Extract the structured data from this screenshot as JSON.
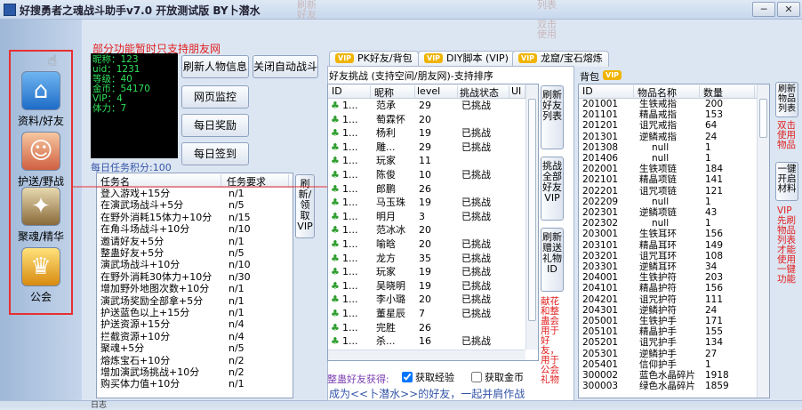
{
  "window": {
    "title": "好搜勇者之魂战斗助手v7.0 开放测试版 BY卜潜水",
    "ghost_labels": [
      "刷新好友",
      "列表",
      "双击使用"
    ],
    "minimize": "─",
    "close": "✕"
  },
  "nav": [
    {
      "label": "资料/好友",
      "icon": "home-icon"
    },
    {
      "label": "护送/野战",
      "icon": "people-icon"
    },
    {
      "label": "聚魂/精华",
      "icon": "items-icon"
    },
    {
      "label": "公会",
      "icon": "guild-icon"
    }
  ],
  "notice": "部分功能暂时只支持朋友网",
  "stats": [
    "昵称：123",
    "uid：1231",
    "等级：40",
    "金币：54170",
    "VIP：4",
    "体力：7"
  ],
  "buttons": {
    "refresh_info": "刷新人物信息",
    "close_auto": "关闭自动战斗",
    "web_monitor": "网页监控",
    "daily_reward": "每日奖励",
    "daily_signin": "每日签到",
    "refresh_receive_vip": "刷新/领取VIP",
    "refresh_friends": "刷新好友列表",
    "challenge_all_vip": "挑战全部好友VIP",
    "refresh_gift_id": "刷新赠送礼物ID",
    "one_click_open": "一键开启材料",
    "refresh_items_list": "刷新物品列表"
  },
  "daily_task": {
    "points_label": "每日任务积分:100",
    "columns": [
      "任务名",
      "任务要求"
    ],
    "rows": [
      [
        "登入游戏+15分",
        "n/1"
      ],
      [
        "在演武场战斗+5分",
        "n/5"
      ],
      [
        "在野外消耗15体力+10分",
        "n/15"
      ],
      [
        "在角斗场战斗+10分",
        "n/10"
      ],
      [
        "邀请好友+5分",
        "n/1"
      ],
      [
        "整蛊好友+5分",
        "n/5"
      ],
      [
        "演武场战斗+10分",
        "n/10"
      ],
      [
        "在野外消耗30体力+10分",
        "n/30"
      ],
      [
        "增加野外地图次数+10分",
        "n/1"
      ],
      [
        "演武场奖励全部拿+5分",
        "n/1"
      ],
      [
        "护送蓝色以上+15分",
        "n/1"
      ],
      [
        "护送资源+15分",
        "n/4"
      ],
      [
        "拦截资源+10分",
        "n/4"
      ],
      [
        "聚魂+5分",
        "n/5"
      ],
      [
        "熔炼宝石+10分",
        "n/2"
      ],
      [
        "增加演武场挑战+10分",
        "n/2"
      ],
      [
        "购买体力值+10分",
        "n/1"
      ]
    ]
  },
  "tabs": [
    "PK好友/背包",
    "DIY脚本 (VIP)",
    "龙窟/宝石熔炼"
  ],
  "tab_vip_badge": "VIP",
  "friends": {
    "heading": "好友挑战 (支持空间/朋友网)-支持排序",
    "columns": [
      "ID",
      "昵称",
      "level",
      "挑战状态",
      "UI"
    ],
    "rows": [
      [
        "1...",
        "范承",
        "29",
        "已挑战"
      ],
      [
        "1...",
        "萄霖怀",
        "20",
        ""
      ],
      [
        "1...",
        "杨利",
        "19",
        "已挑战"
      ],
      [
        "1...",
        "雕...",
        "29",
        "已挑战"
      ],
      [
        "1...",
        "玩家",
        "11",
        ""
      ],
      [
        "1...",
        "陈俊",
        "10",
        "已挑战"
      ],
      [
        "1...",
        "郎鹏",
        "26",
        ""
      ],
      [
        "1...",
        "马玉珠",
        "19",
        "已挑战"
      ],
      [
        "1...",
        "明月",
        "3",
        "已挑战"
      ],
      [
        "1...",
        "范冰冰",
        "20",
        ""
      ],
      [
        "1...",
        "喻晗",
        "20",
        "已挑战"
      ],
      [
        "1...",
        "龙方",
        "35",
        "已挑战"
      ],
      [
        "1...",
        "玩家",
        "19",
        "已挑战"
      ],
      [
        "1...",
        "吴晓明",
        "19",
        "已挑战"
      ],
      [
        "1...",
        "李小璐",
        "20",
        "已挑战"
      ],
      [
        "1...",
        "董星辰",
        "7",
        "已挑战"
      ],
      [
        "1...",
        "完胜",
        "26",
        ""
      ],
      [
        "1...",
        "杀...",
        "16",
        "已挑战"
      ]
    ],
    "side_note": "献花和整蛊会用于好友，用于公会礼物",
    "gift_label": "整蛊好友获得:",
    "opt_exp": "获取经验",
    "opt_gold": "获取金币",
    "opt_exp_checked": true,
    "opt_gold_checked": false,
    "footer": "成为<<卜潜水>>的好友，一起并肩作战"
  },
  "bag": {
    "title": "背包",
    "columns": [
      "ID",
      "物品名称",
      "数量"
    ],
    "rows": [
      [
        "201001",
        "生铁戒指",
        "200"
      ],
      [
        "201101",
        "精晶戒指",
        "153"
      ],
      [
        "201201",
        "诅咒戒指",
        "64"
      ],
      [
        "201301",
        "逆鳞戒指",
        "24"
      ],
      [
        "201308",
        "null",
        "1"
      ],
      [
        "201406",
        "null",
        "1"
      ],
      [
        "202001",
        "生铁项链",
        "184"
      ],
      [
        "202101",
        "精晶项链",
        "141"
      ],
      [
        "202201",
        "诅咒项链",
        "121"
      ],
      [
        "202209",
        "null",
        "1"
      ],
      [
        "202301",
        "逆鳞项链",
        "43"
      ],
      [
        "202302",
        "null",
        "1"
      ],
      [
        "203001",
        "生铁耳环",
        "156"
      ],
      [
        "203101",
        "精晶耳环",
        "149"
      ],
      [
        "203201",
        "诅咒耳环",
        "108"
      ],
      [
        "203301",
        "逆鳞耳环",
        "34"
      ],
      [
        "204001",
        "生铁护符",
        "203"
      ],
      [
        "204101",
        "精晶护符",
        "156"
      ],
      [
        "204201",
        "诅咒护符",
        "111"
      ],
      [
        "204301",
        "逆鳞护符",
        "24"
      ],
      [
        "205001",
        "生铁护手",
        "171"
      ],
      [
        "205101",
        "精晶护手",
        "155"
      ],
      [
        "205201",
        "诅咒护手",
        "134"
      ],
      [
        "205301",
        "逆鳞护手",
        "27"
      ],
      [
        "205401",
        "信仰护手",
        "1"
      ],
      [
        "300002",
        "蓝色水晶碎片",
        "1918"
      ],
      [
        "300003",
        "绿色水晶碎片",
        "1859"
      ]
    ]
  },
  "right_notes": {
    "dbl_click": "双击使用物品",
    "vip_note": "VIP先刷物品列表才能使用一键功能"
  },
  "status_bar": "日志"
}
